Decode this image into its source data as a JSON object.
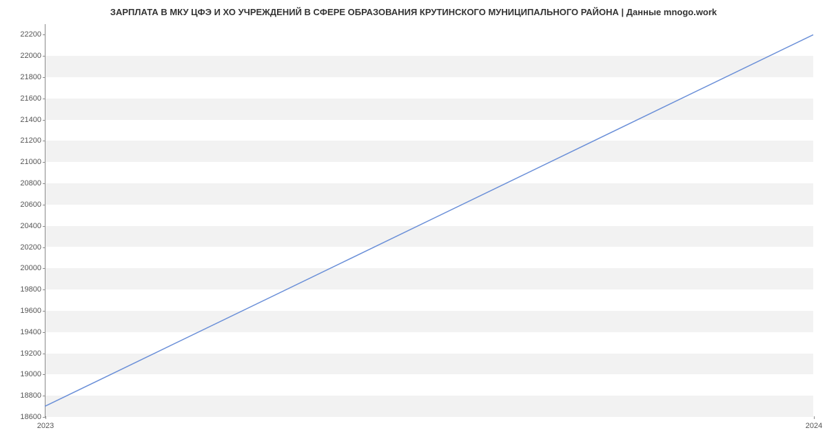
{
  "chart_data": {
    "type": "line",
    "title": "ЗАРПЛАТА В МКУ  ЦФЭ И ХО УЧРЕЖДЕНИЙ В СФЕРЕ ОБРАЗОВАНИЯ КРУТИНСКОГО МУНИЦИПАЛЬНОГО РАЙОНА | Данные mnogo.work",
    "x": [
      2023,
      2024
    ],
    "values": [
      18700,
      22200
    ],
    "x_ticks": [
      2023,
      2024
    ],
    "y_ticks": [
      18600,
      18800,
      19000,
      19200,
      19400,
      19600,
      19800,
      20000,
      20200,
      20400,
      20600,
      20800,
      21000,
      21200,
      21400,
      21600,
      21800,
      22000,
      22200
    ],
    "xlim": [
      2023,
      2024
    ],
    "ylim": [
      18600,
      22300
    ],
    "line_color": "#6a8fd8",
    "xlabel": "",
    "ylabel": ""
  }
}
